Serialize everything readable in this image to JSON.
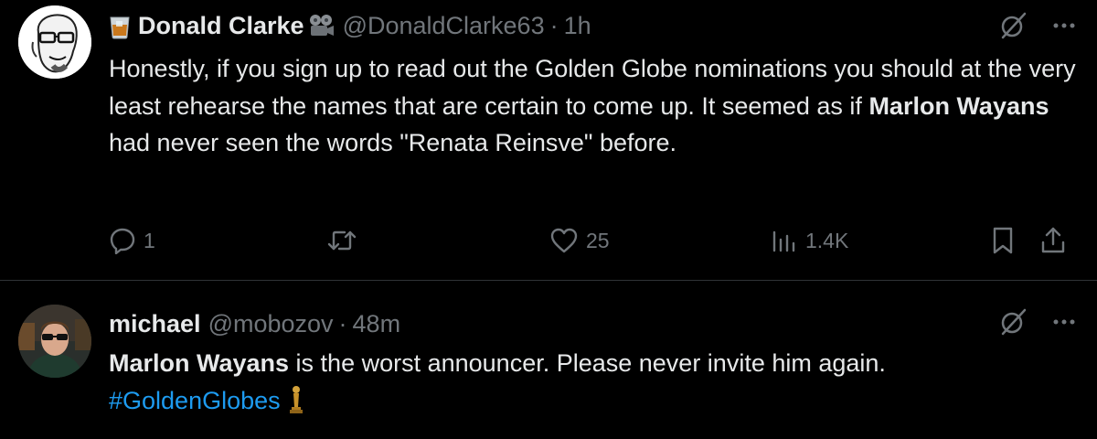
{
  "tweets": [
    {
      "name": "Donald Clarke",
      "handle": "@DonaldClarke63",
      "separator": "·",
      "time": "1h",
      "text": {
        "part1": "Honestly, if you sign up to read out the Golden Globe nominations you should at the very least rehearse the names that are certain to come up. It seemed as if ",
        "bold": "Marlon Wayans",
        "part2": " had never seen the words \"Renata Reinsve\" before."
      },
      "actions": {
        "replies": "1",
        "likes": "25",
        "views": "1.4K"
      }
    },
    {
      "name": "michael",
      "handle": "@mobozov",
      "separator": "·",
      "time": "48m",
      "text": {
        "bold": "Marlon Wayans",
        "part1": " is the worst announcer. Please never invite him again.",
        "hashtag": "#GoldenGlobes"
      }
    }
  ],
  "icons": {
    "more": "more-dots-icon",
    "grok": "grok-icon",
    "reply": "reply-icon",
    "retweet": "retweet-icon",
    "like": "heart-icon",
    "views": "views-icon",
    "bookmark": "bookmark-icon",
    "share": "share-icon"
  },
  "colors": {
    "background": "#000000",
    "text": "#e7e9ea",
    "secondary": "#71767b",
    "link": "#1d9bf0",
    "divider": "#2f3336"
  }
}
